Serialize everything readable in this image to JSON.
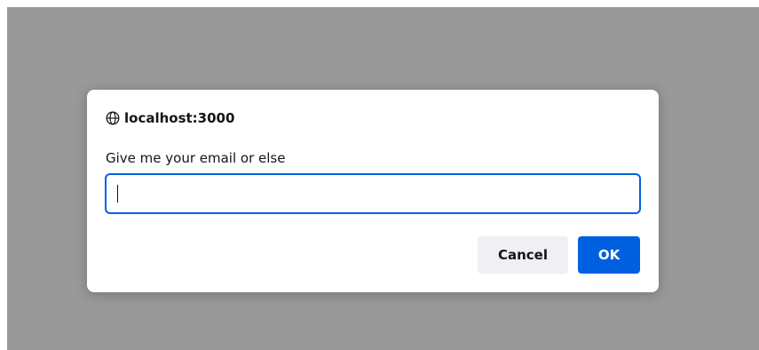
{
  "dialog": {
    "origin": "localhost:3000",
    "origin_icon": "globe-icon",
    "message": "Give me your email or else",
    "input": {
      "value": "",
      "placeholder": ""
    },
    "cancel_label": "Cancel",
    "ok_label": "OK"
  },
  "colors": {
    "backdrop": "#99999a",
    "accent": "#0061e0",
    "cancel_bg": "#f0f0f4",
    "text": "#15141a"
  }
}
